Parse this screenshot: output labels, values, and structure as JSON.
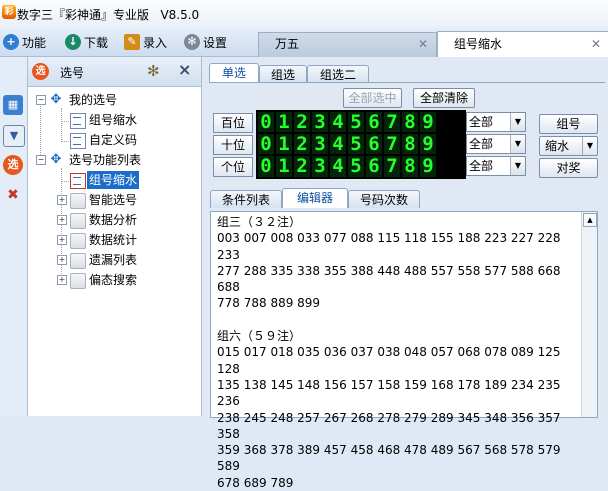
{
  "app": {
    "title": "数字三『彩神通』专业版   V8.5.0",
    "logo_text": "彩"
  },
  "toolbar": {
    "items": [
      {
        "label": "功能",
        "icon": "plus-icon"
      },
      {
        "label": "下载",
        "icon": "download-icon"
      },
      {
        "label": "录入",
        "icon": "pen-icon"
      },
      {
        "label": "设置",
        "icon": "gear-icon"
      }
    ]
  },
  "doc_tabs": [
    {
      "label": "万五",
      "close": "✕"
    },
    {
      "label": "组号缩水",
      "close": "✕"
    }
  ],
  "strip": {
    "badge": "选"
  },
  "tree": {
    "header": {
      "badge": "选",
      "title": "选号"
    },
    "nodes": [
      {
        "label": "我的选号",
        "pm": "−"
      },
      {
        "label": "组号缩水"
      },
      {
        "label": "自定义码"
      },
      {
        "label": "选号功能列表",
        "pm": "−"
      },
      {
        "label": "组号缩水"
      },
      {
        "label": "智能选号",
        "pm": "+"
      },
      {
        "label": "数据分析",
        "pm": "+"
      },
      {
        "label": "数据统计",
        "pm": "+"
      },
      {
        "label": "遗漏列表",
        "pm": "+"
      },
      {
        "label": "偏态搜索",
        "pm": "+"
      }
    ]
  },
  "main": {
    "top_tabs": [
      "单选",
      "组选",
      "组选二"
    ],
    "select_all": "全部选中",
    "clear_all": "全部清除",
    "positions": [
      "百位",
      "十位",
      "个位"
    ],
    "digits": [
      "0",
      "1",
      "2",
      "3",
      "4",
      "5",
      "6",
      "7",
      "8",
      "9"
    ],
    "filter_value": "全部",
    "actions": {
      "group": "组号",
      "shrink": "缩水",
      "compare": "对奖"
    },
    "bottom_tabs": [
      "条件列表",
      "编辑器",
      "号码次数"
    ],
    "editor_text": "组三（３２注）\n003 007 008 033 077 088 115 118 155 188 223 227 228 233\n277 288 335 338 355 388 448 488 557 558 577 588 668 688\n778 788 889 899\n\n组六（５９注）\n015 017 018 035 036 037 038 048 057 068 078 089 125 128\n135 138 145 148 156 157 158 159 168 178 189 234 235 236\n238 245 248 257 267 268 278 279 289 345 348 356 357 358\n359 368 378 389 457 458 468 478 489 567 568 578 579 589\n678 689 789"
  }
}
